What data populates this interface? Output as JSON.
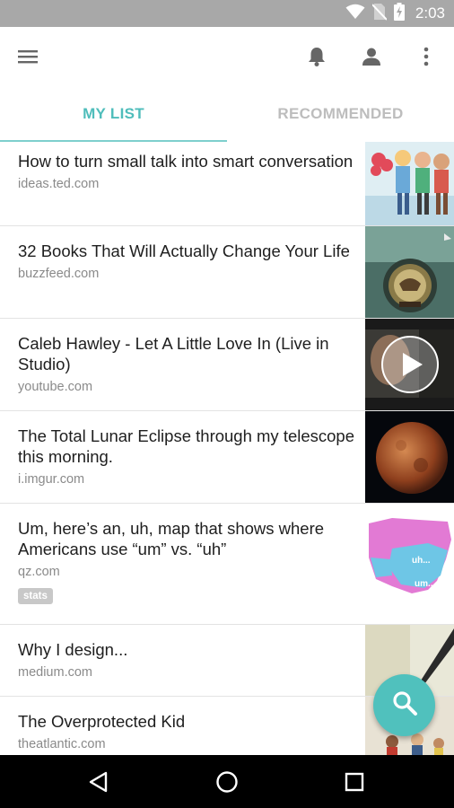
{
  "status_bar": {
    "time": "2:03",
    "icons": [
      "wifi-icon",
      "no-sim-icon",
      "battery-charging-icon"
    ],
    "background": "#a8a8a8"
  },
  "app_bar": {
    "icons": [
      "menu-icon",
      "notifications-bell-icon",
      "account-icon",
      "overflow-menu-icon"
    ]
  },
  "tabs": [
    {
      "label": "MY LIST",
      "active": true
    },
    {
      "label": "RECOMMENDED",
      "active": false
    }
  ],
  "accent_color": "#4fbdbb",
  "articles": [
    {
      "title": "How to turn small talk into smart conversation",
      "domain": "ideas.ted.com",
      "tags": []
    },
    {
      "title": "32 Books That Will Actually Change Your Life",
      "domain": "buzzfeed.com",
      "tags": []
    },
    {
      "title": "Caleb Hawley - Let A Little Love In (Live in Studio)",
      "domain": "youtube.com",
      "tags": [],
      "video": true
    },
    {
      "title": "The Total Lunar Eclipse through my telescope this morning.",
      "domain": "i.imgur.com",
      "tags": []
    },
    {
      "title": "Um, here’s an, uh, map that shows where Americans use “um” vs. “uh”",
      "domain": "qz.com",
      "tags": [
        "stats"
      ],
      "thumb_text": [
        "uh...",
        "um..."
      ]
    },
    {
      "title": "Why I design...",
      "domain": "medium.com",
      "tags": []
    },
    {
      "title": "The Overprotected Kid",
      "domain": "theatlantic.com",
      "tags": []
    }
  ],
  "fab": {
    "icon": "search-icon"
  },
  "nav_bar": {
    "icons": [
      "back-icon",
      "home-icon",
      "recents-icon"
    ]
  }
}
